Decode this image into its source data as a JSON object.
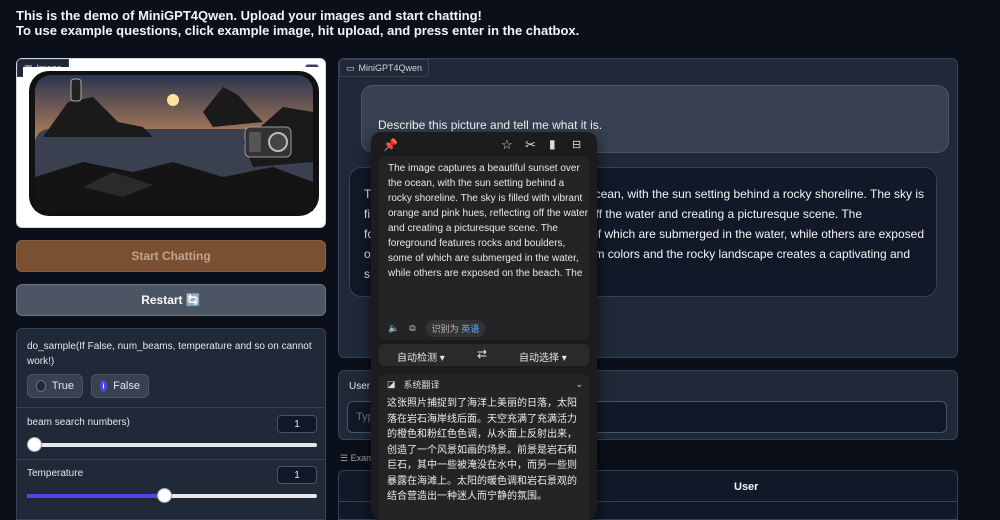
{
  "intro": {
    "line1": "This is the demo of MiniGPT4Qwen. Upload your images and start chatting!",
    "line2": "To use example questions, click example image, hit upload, and press enter in the chatbox."
  },
  "image_panel": {
    "label": "Image"
  },
  "buttons": {
    "start": "Start Chatting",
    "restart": "Restart 🔄"
  },
  "controls": {
    "do_sample_label": "do_sample(If False, num_beams, temperature and so on cannot work!)",
    "true_label": "True",
    "false_label": "False",
    "selected": "False",
    "beam_label": "beam search numbers)",
    "beam_value": "1",
    "beam_fraction": 0.0,
    "temp_label": "Temperature",
    "temp_value": "1",
    "temp_fraction": 0.47
  },
  "chat": {
    "label": "MiniGPT4Qwen",
    "user_msg": "Describe this picture and tell me what it is.",
    "bot_lines": [
      "T",
      "fi",
      "fo",
      "o",
      "s"
    ],
    "bot_visible": [
      "ocean, with the sun setting behind a rocky shoreline. The sky is",
      "ting off the water and creating a picturesque scene. The",
      "of which are submerged in the water, while others are exposed",
      "rm colors and the rocky landscape creates a captivating and",
      ""
    ]
  },
  "input_area": {
    "label": "User",
    "placeholder": "Typ"
  },
  "examples": {
    "label": "Exam",
    "header": "User"
  },
  "popup": {
    "english": "The image captures a beautiful sunset over the ocean, with the sun setting behind a rocky shoreline. The sky is filled with vibrant orange and pink hues, reflecting off the water and creating a picturesque scene. The foreground features rocks and boulders, some of which are submerged in the water, while others are exposed on the beach. The",
    "detected_label": "识别为",
    "detected_lang": "英语",
    "src_lang": "自动检测",
    "tgt_lang": "自动选择",
    "service": "系统翻译",
    "chinese": "这张照片捕捉到了海洋上美丽的日落，太阳落在岩石海岸线后面。天空充满了充满活力的橙色和粉红色色调，从水面上反射出来，创造了一个风景如画的场景。前景是岩石和巨石，其中一些被淹没在水中，而另一些则暴露在海滩上。太阳的暖色调和岩石景观的结合营造出一种迷人而宁静的氛围。"
  },
  "colors": {
    "accent": "#4f46e5",
    "start_button": "#7a5032",
    "background": "#0b0f19"
  }
}
